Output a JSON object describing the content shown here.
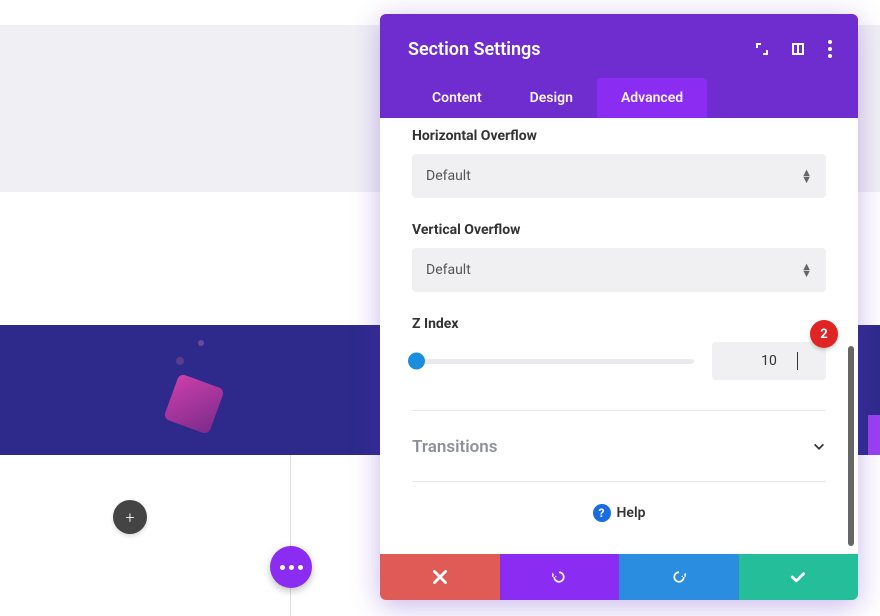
{
  "modal": {
    "title": "Section Settings",
    "tabs": {
      "content": "Content",
      "design": "Design",
      "advanced": "Advanced",
      "active": "advanced"
    }
  },
  "fields": {
    "horiz_overflow": {
      "label": "Horizontal Overflow",
      "value": "Default"
    },
    "vert_overflow": {
      "label": "Vertical Overflow",
      "value": "Default"
    },
    "z_index": {
      "label": "Z Index",
      "value": "10",
      "badge": "2"
    }
  },
  "transitions": {
    "label": "Transitions"
  },
  "help": {
    "label": "Help"
  },
  "icons": {
    "add": "+",
    "select_chevron": "⌃⌄"
  }
}
